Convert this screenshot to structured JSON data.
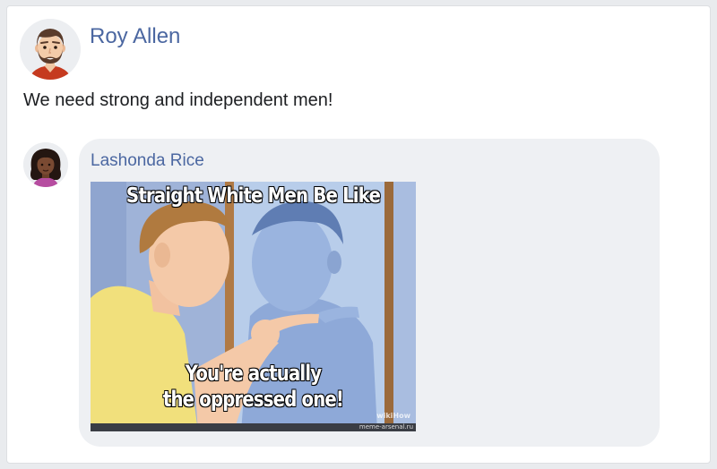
{
  "post": {
    "author_name": "Roy Allen",
    "text": "We need strong and independent men!"
  },
  "comment": {
    "author_name": "Lashonda Rice",
    "image": {
      "top_caption": "Straight White Men Be Like",
      "bottom_caption_line1": "You're actually",
      "bottom_caption_line2": "the oppressed one!",
      "watermark": "wikiHow",
      "credit": "meme-arsenal.ru"
    }
  },
  "colors": {
    "link": "#4b67a1",
    "bubble": "#eef0f3",
    "background": "#e9ebee"
  }
}
